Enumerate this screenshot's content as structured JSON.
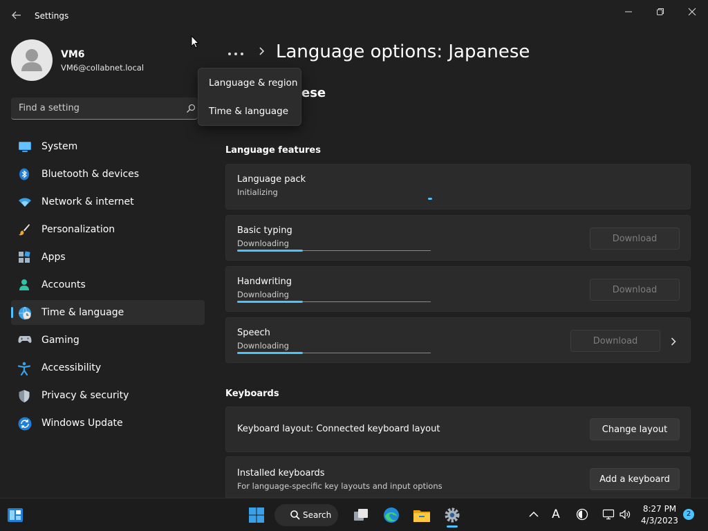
{
  "window": {
    "app_title": "Settings",
    "back_icon": "back-arrow-icon",
    "controls": [
      "minimize-icon",
      "restore-icon",
      "close-icon"
    ]
  },
  "profile": {
    "name": "VM6",
    "email": "VM6@collabnet.local"
  },
  "search": {
    "placeholder": "Find a setting"
  },
  "sidebar": {
    "items": [
      {
        "label": "System",
        "icon": "system-icon",
        "active": false
      },
      {
        "label": "Bluetooth & devices",
        "icon": "bluetooth-icon",
        "active": false
      },
      {
        "label": "Network & internet",
        "icon": "wifi-icon",
        "active": false
      },
      {
        "label": "Personalization",
        "icon": "paintbrush-icon",
        "active": false
      },
      {
        "label": "Apps",
        "icon": "apps-icon",
        "active": false
      },
      {
        "label": "Accounts",
        "icon": "accounts-icon",
        "active": false
      },
      {
        "label": "Time & language",
        "icon": "time-language-icon",
        "active": true
      },
      {
        "label": "Gaming",
        "icon": "gamepad-icon",
        "active": false
      },
      {
        "label": "Accessibility",
        "icon": "accessibility-icon",
        "active": false
      },
      {
        "label": "Privacy & security",
        "icon": "shield-icon",
        "active": false
      },
      {
        "label": "Windows Update",
        "icon": "update-icon",
        "active": false
      }
    ]
  },
  "header": {
    "title": "Language options: Japanese",
    "subtitle_fragment": "ese"
  },
  "breadcrumb_menu": {
    "items": [
      "Language & region",
      "Time & language"
    ]
  },
  "language_features": {
    "heading": "Language features",
    "language_pack": {
      "title": "Language pack",
      "status": "Initializing"
    },
    "basic_typing": {
      "title": "Basic typing",
      "status": "Downloading",
      "button": "Download",
      "progress": 0.34
    },
    "handwriting": {
      "title": "Handwriting",
      "status": "Downloading",
      "button": "Download",
      "progress": 0.34
    },
    "speech": {
      "title": "Speech",
      "status": "Downloading",
      "button": "Download",
      "progress": 0.34
    }
  },
  "keyboards": {
    "heading": "Keyboards",
    "layout": {
      "title": "Keyboard layout: Connected keyboard layout",
      "button": "Change layout"
    },
    "installed": {
      "title": "Installed keyboards",
      "subtitle": "For language-specific key layouts and input options",
      "button": "Add a keyboard"
    }
  },
  "taskbar": {
    "search_label": "Search",
    "time": "8:27 PM",
    "date": "4/3/2023",
    "notification_count": "2",
    "ime_indicator": "A"
  },
  "colors": {
    "accent": "#4cc2ff",
    "background": "#202020",
    "card": "#2b2b2b"
  }
}
